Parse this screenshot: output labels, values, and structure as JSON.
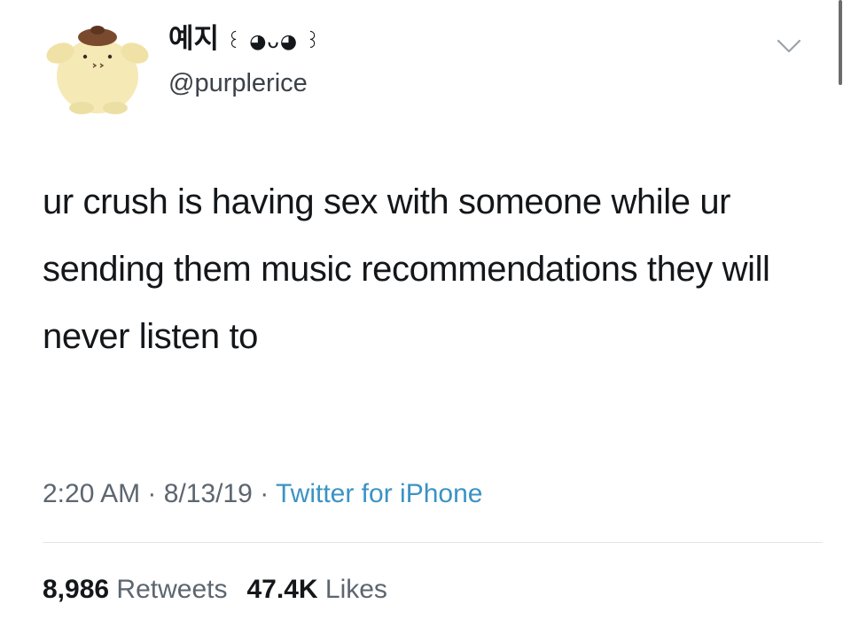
{
  "user": {
    "display_name": "예지",
    "emoticon": "꒰ ◕ᴗ◕ ꒱",
    "handle": "@purplerice",
    "avatar": "pompompurin-plush-avatar"
  },
  "tweet": {
    "text": "ur crush is having sex with someone while ur sending them music recommendations they will never listen to"
  },
  "meta": {
    "time": "2:20 AM",
    "separator": "·",
    "date": "8/13/19",
    "source": "Twitter for iPhone"
  },
  "stats": {
    "retweets_count": "8,986",
    "retweets_label": "Retweets",
    "likes_count": "47.4K",
    "likes_label": "Likes"
  },
  "icons": {
    "menu": "chevron-down-icon"
  },
  "colors": {
    "text": "#14171a",
    "secondary": "#5c6670",
    "link": "#3a93c4",
    "divider": "#e3e6e8"
  }
}
